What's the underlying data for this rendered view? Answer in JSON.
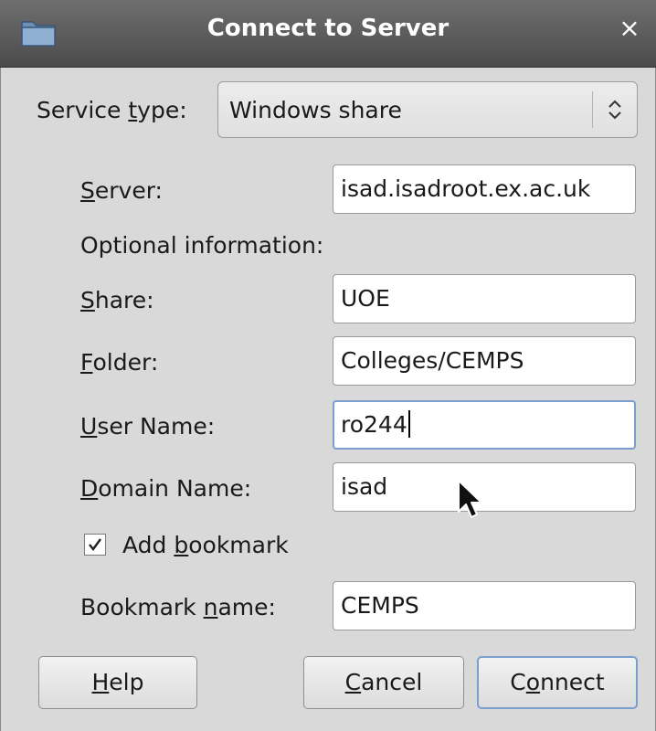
{
  "window": {
    "title": "Connect to Server",
    "close_glyph": "×",
    "icon": "folder-icon"
  },
  "service": {
    "label_prefix": "Service ",
    "label_mnemonic": "t",
    "label_suffix": "ype:",
    "value": "Windows share"
  },
  "server": {
    "label_mnemonic": "S",
    "label_rest": "erver:",
    "value": "isad.isadroot.ex.ac.uk"
  },
  "optional_header": "Optional information:",
  "share": {
    "label_mnemonic": "S",
    "label_rest": "hare:",
    "value": "UOE"
  },
  "folder": {
    "label_mnemonic": "F",
    "label_rest": "older:",
    "value": "Colleges/CEMPS"
  },
  "user_name": {
    "label_mnemonic": "U",
    "label_rest": "ser Name:",
    "value": "ro244"
  },
  "domain_name": {
    "label_mnemonic": "D",
    "label_rest": "omain Name:",
    "value": "isad"
  },
  "bookmark": {
    "checked": true,
    "check_prefix": "Add ",
    "check_mnemonic": "b",
    "check_suffix": "ookmark",
    "name_label_prefix": "Bookmark ",
    "name_label_mnemonic": "n",
    "name_label_suffix": "ame:",
    "name_value": "CEMPS"
  },
  "buttons": {
    "help_mnemonic": "H",
    "help_rest": "elp",
    "cancel_mnemonic": "C",
    "cancel_rest": "ancel",
    "connect_prefix": "C",
    "connect_mnemonic": "o",
    "connect_suffix": "nnect"
  },
  "colors": {
    "titlebar": "#5a5a5a",
    "focus": "#7a9fcf",
    "background": "#d9d9d9"
  }
}
